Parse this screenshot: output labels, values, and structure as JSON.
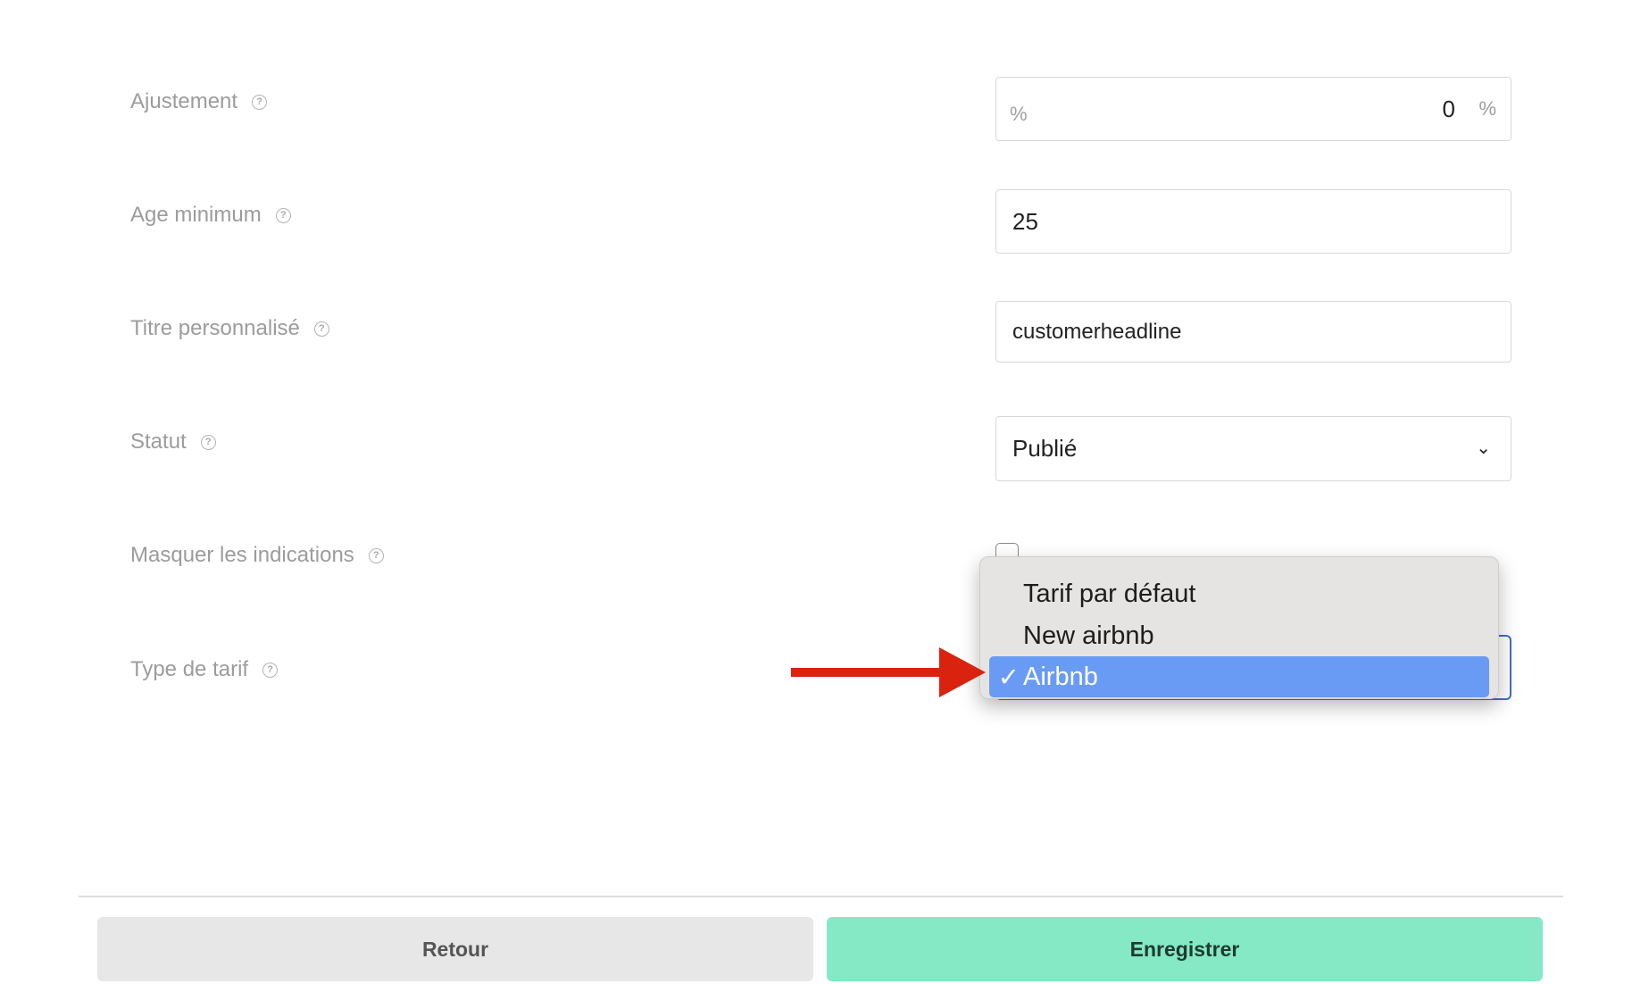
{
  "form": {
    "ajustement": {
      "label": "Ajustement",
      "prefix": "%",
      "value": "0",
      "suffix": "%"
    },
    "age_minimum": {
      "label": "Age minimum",
      "value": "25"
    },
    "titre_personnalise": {
      "label": "Titre personnalisé",
      "value": "customerheadline"
    },
    "statut": {
      "label": "Statut",
      "selected": "Publié"
    },
    "masquer_indications": {
      "label": "Masquer les indications",
      "checked": false
    },
    "type_de_tarif": {
      "label": "Type de tarif",
      "options": [
        {
          "label": "Tarif par défaut",
          "selected": false
        },
        {
          "label": "New airbnb",
          "selected": false
        },
        {
          "label": "Airbnb",
          "selected": true,
          "check": "✓"
        }
      ]
    }
  },
  "icons": {
    "help": "?",
    "chevron": "⌄"
  },
  "colors": {
    "label_text": "#9c9c9c",
    "selected_option": "#6a9bf4",
    "focus_border": "#3a6fd0",
    "arrow": "#d9230f",
    "save_button": "#84e9c4",
    "back_button": "#e7e7e7"
  },
  "footer": {
    "back_label": "Retour",
    "save_label": "Enregistrer"
  }
}
